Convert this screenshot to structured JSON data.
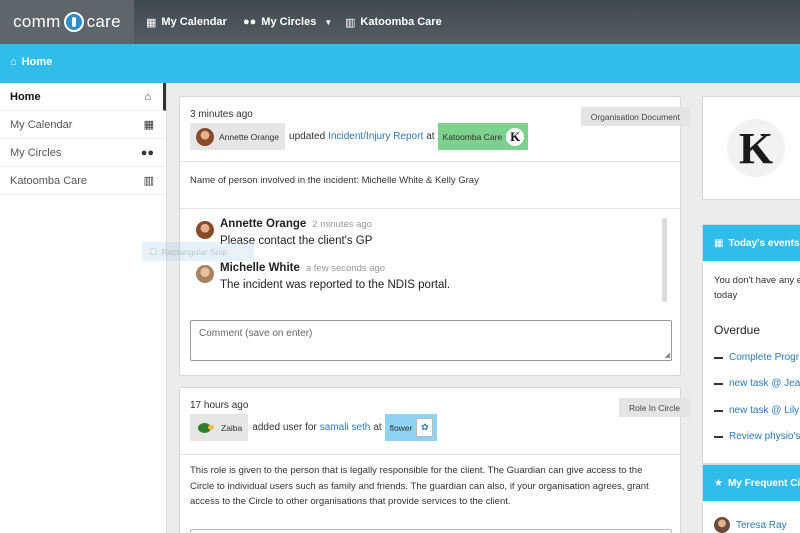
{
  "app": {
    "logo_left": "comm",
    "logo_right": "care"
  },
  "nav": [
    {
      "label": "My Calendar",
      "icon": "calendar-icon"
    },
    {
      "label": "My Circles",
      "icon": "users-icon"
    },
    {
      "label": "Katoomba Care",
      "icon": "building-icon"
    }
  ],
  "bluebar": {
    "label": "Home"
  },
  "sidebar": {
    "items": [
      {
        "label": "Home",
        "icon": "home-icon",
        "active": true
      },
      {
        "label": "My Calendar",
        "icon": "calendar-icon"
      },
      {
        "label": "My Circles",
        "icon": "users-icon"
      },
      {
        "label": "Katoomba Care",
        "icon": "building-icon"
      }
    ]
  },
  "activity1": {
    "time": "3 minutes ago",
    "type": "Organisation Document",
    "user": "Annette Orange",
    "verb": "updated",
    "object": "Incident/Injury Report",
    "at": "at",
    "org": "Katoomba Care",
    "org_initial": "K",
    "description": "Name of person involved in the incident: Michelle White & Kelly Gray",
    "comments": [
      {
        "author": "Annette Orange",
        "time": "2 minutes ago",
        "text": "Please contact the client's GP"
      },
      {
        "author": "Michelle White",
        "time": "a few seconds ago",
        "text": "The incident was reported to the NDIS portal."
      }
    ],
    "comment_placeholder": "Comment (save on enter)"
  },
  "activity2": {
    "time": "17 hours ago",
    "type": "Role In Circle",
    "user": "Zaiba",
    "verb": "added user for",
    "object": "samali seth",
    "at": "at",
    "org": "flower",
    "description": "This role is given to the person that is legally responsible for the client. The Guardian can give access to the Circle to individual users such as family and friends. The guardian can also, if your organisation agrees, grant access to the Circle to other organisations that provide services to the client."
  },
  "ghost": {
    "label": "Rectangular Snip"
  },
  "org_card": {
    "initial": "K"
  },
  "events": {
    "title": "Today's events",
    "empty_line1": "You don't have any e",
    "empty_line2": "today",
    "overdue_title": "Overdue",
    "overdue_items": [
      "Complete Progr",
      "new task @ Jean",
      "new task @ Lily",
      "Review physio's"
    ]
  },
  "frequent": {
    "title": "My Frequent Ci",
    "items": [
      "Teresa Ray"
    ]
  },
  "colors": {
    "accent": "#30bde9",
    "link": "#2a7ab8",
    "org_green": "#7cd18c",
    "org_blue": "#8fd3f2"
  }
}
